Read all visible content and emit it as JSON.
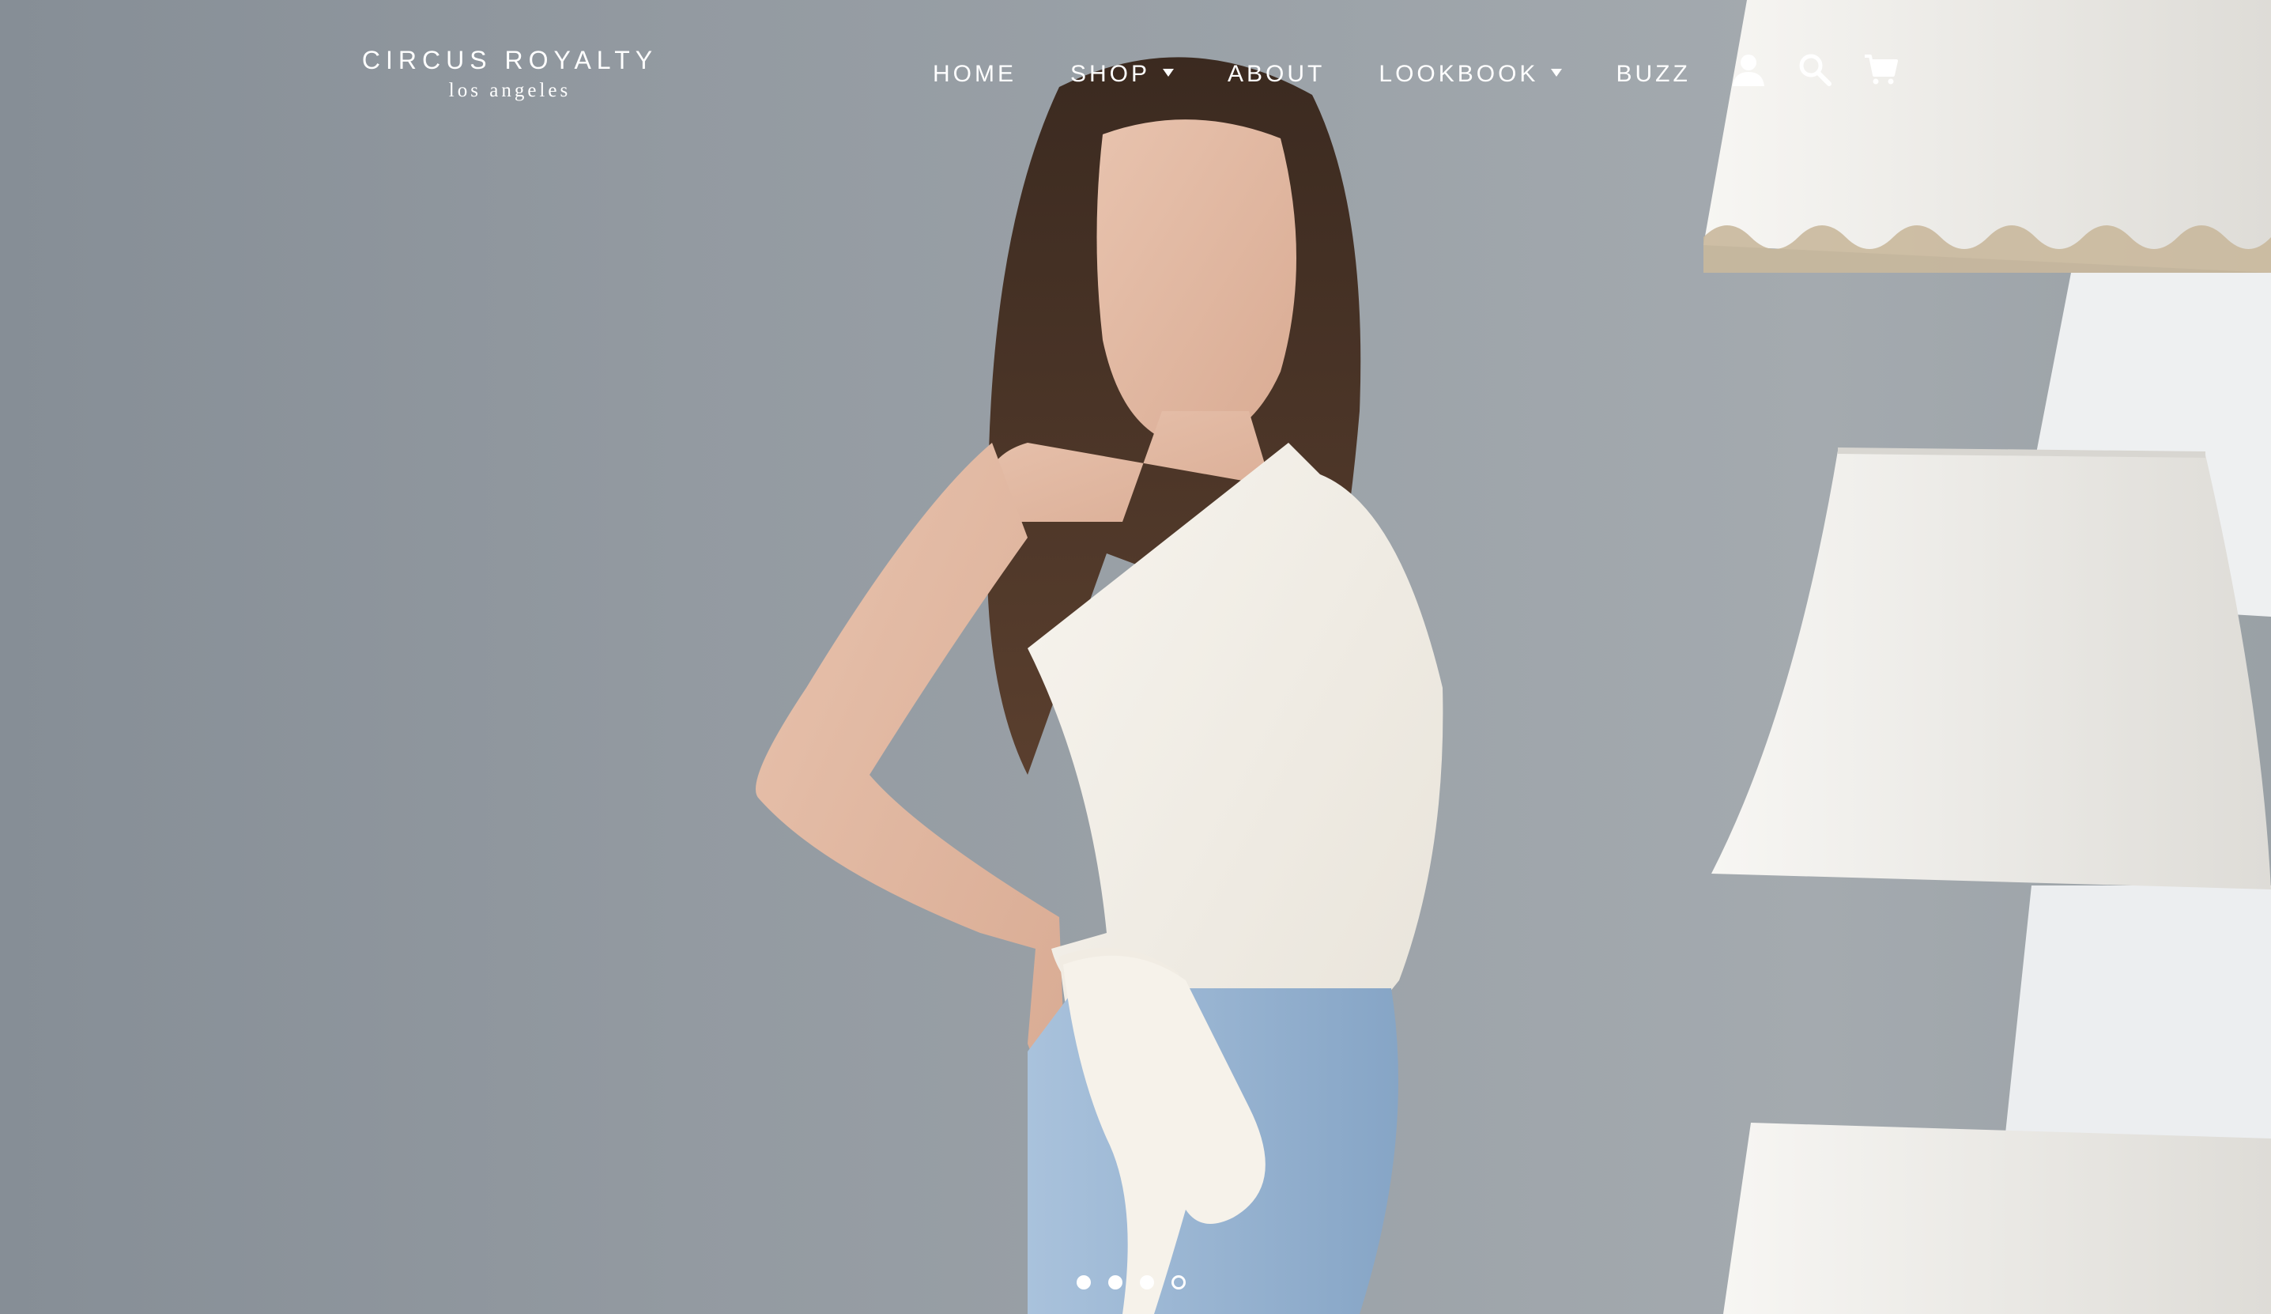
{
  "brand": {
    "name": "CIRCUS ROYALTY",
    "tagline": "los angeles"
  },
  "nav": {
    "items": [
      {
        "label": "HOME",
        "dropdown": false
      },
      {
        "label": "SHOP",
        "dropdown": true
      },
      {
        "label": "ABOUT",
        "dropdown": false
      },
      {
        "label": "LOOKBOOK",
        "dropdown": true
      },
      {
        "label": "BUZZ",
        "dropdown": false
      }
    ]
  },
  "icons": [
    "account-icon",
    "search-icon",
    "cart-icon"
  ],
  "hero": {
    "slides_total": 4,
    "active_slide": 4
  },
  "colors": {
    "background": "#939aa1",
    "nav_text": "#ffffff",
    "top_garment": "#f4f1ea",
    "jeans": "#9db8d4",
    "lampshade": "#f2f1ee"
  }
}
